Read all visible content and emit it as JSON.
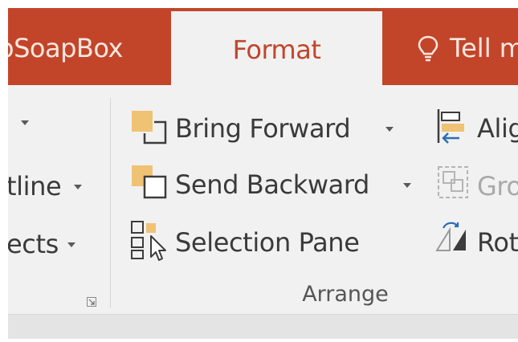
{
  "tabs": {
    "soapbox_label": "oSoapBox",
    "format_label": "Format",
    "tell_label": "Tell me"
  },
  "left_group": {
    "outline_label": "tline",
    "effects_label": "ects"
  },
  "arrange": {
    "bring_forward_label": "Bring Forward",
    "send_backward_label": "Send Backward",
    "selection_pane_label": "Selection Pane",
    "align_label": "Align",
    "group_label": "Group",
    "rotate_label": "Rotate",
    "group_name": "Arrange"
  },
  "icons": {
    "lightbulb": "lightbulb-icon",
    "bring_forward": "bring-forward-icon",
    "send_backward": "send-backward-icon",
    "selection_pane": "selection-pane-icon",
    "align": "align-icon",
    "group": "group-icon",
    "rotate": "rotate-icon",
    "dialog_launcher": "dialog-launcher-icon"
  },
  "colors": {
    "accent": "#c2452a",
    "shape_fill": "#f0c274",
    "align_accent": "#2f6db5"
  }
}
